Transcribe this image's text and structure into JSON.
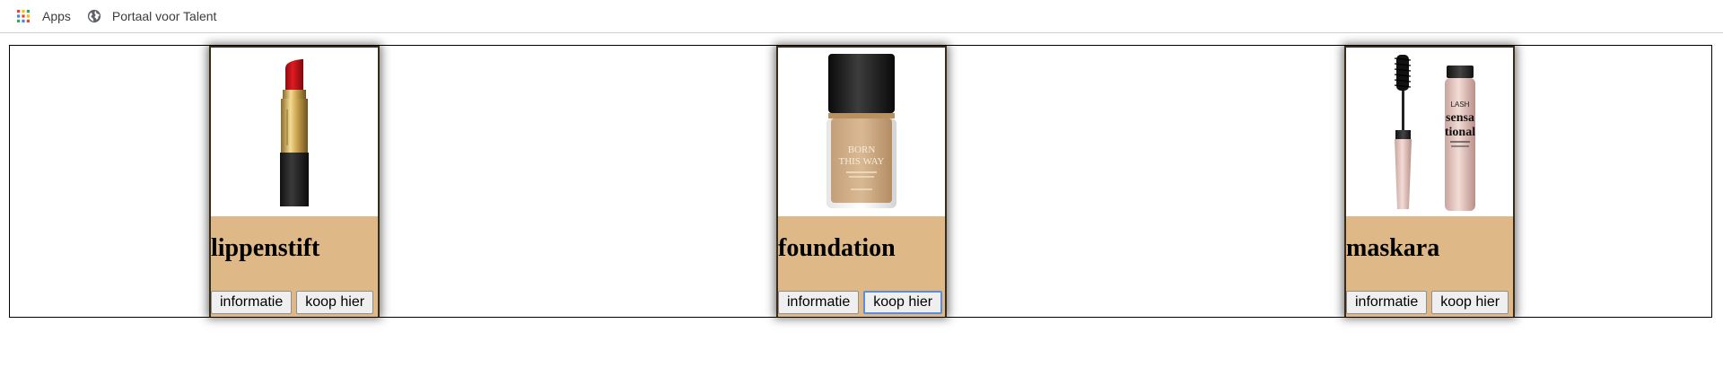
{
  "bookmarks": {
    "items": [
      {
        "label": "Apps",
        "icon": "apps-grid-icon"
      },
      {
        "label": "Portaal voor Talent",
        "icon": "globe-icon"
      }
    ]
  },
  "products": [
    {
      "name": "lippenstift",
      "image": "lipstick-image",
      "buttons": {
        "info": "informatie",
        "buy": "koop hier"
      }
    },
    {
      "name": "foundation",
      "image": "foundation-bottle-image",
      "image_text": [
        "BORN",
        "THIS WAY"
      ],
      "buttons": {
        "info": "informatie",
        "buy": "koop hier"
      }
    },
    {
      "name": "maskara",
      "image": "mascara-image",
      "image_text": [
        "LASH",
        "sensa",
        "tional"
      ],
      "buttons": {
        "info": "informatie",
        "buy": "koop hier"
      }
    }
  ],
  "colors": {
    "title_band": "#deb887",
    "card_border": "#3a2b18",
    "focus_ring": "#5b8de0"
  }
}
